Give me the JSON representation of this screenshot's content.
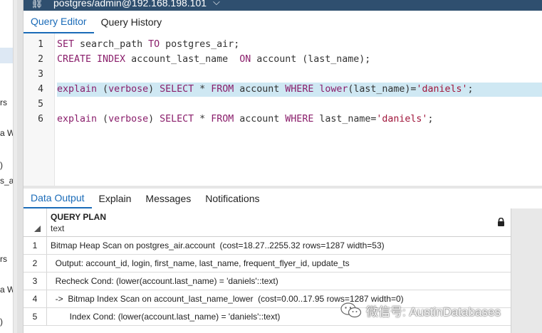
{
  "connection": {
    "title": "postgres/admin@192.168.198.101",
    "chevron": "⌵"
  },
  "editor_tabs": [
    {
      "label": "Query Editor",
      "active": true
    },
    {
      "label": "Query History",
      "active": false
    }
  ],
  "editor": {
    "lines": [
      {
        "num": "1",
        "segments": [
          {
            "t": "SET",
            "k": "kw"
          },
          {
            "t": " search_path ",
            "k": ""
          },
          {
            "t": "TO",
            "k": "kw"
          },
          {
            "t": " postgres_air;",
            "k": ""
          }
        ]
      },
      {
        "num": "2",
        "segments": [
          {
            "t": "CREATE INDEX",
            "k": "kw"
          },
          {
            "t": " account_last_name  ",
            "k": ""
          },
          {
            "t": "ON",
            "k": "kw"
          },
          {
            "t": " account (last_name);",
            "k": ""
          }
        ]
      },
      {
        "num": "3",
        "segments": []
      },
      {
        "num": "4",
        "highlight": true,
        "segments": [
          {
            "t": "explain",
            "k": "kw"
          },
          {
            "t": " (",
            "k": ""
          },
          {
            "t": "verbose",
            "k": "kw"
          },
          {
            "t": ") ",
            "k": ""
          },
          {
            "t": "SELECT",
            "k": "kw"
          },
          {
            "t": " * ",
            "k": ""
          },
          {
            "t": "FROM",
            "k": "kw"
          },
          {
            "t": " account ",
            "k": ""
          },
          {
            "t": "WHERE",
            "k": "kw"
          },
          {
            "t": " ",
            "k": ""
          },
          {
            "t": "lower",
            "k": "kw"
          },
          {
            "t": "(last_name)=",
            "k": ""
          },
          {
            "t": "'daniels'",
            "k": "str"
          },
          {
            "t": ";",
            "k": ""
          }
        ]
      },
      {
        "num": "5",
        "segments": []
      },
      {
        "num": "6",
        "segments": [
          {
            "t": "explain",
            "k": "kw"
          },
          {
            "t": " (",
            "k": ""
          },
          {
            "t": "verbose",
            "k": "kw"
          },
          {
            "t": ") ",
            "k": ""
          },
          {
            "t": "SELECT",
            "k": "kw"
          },
          {
            "t": " * ",
            "k": ""
          },
          {
            "t": "FROM",
            "k": "kw"
          },
          {
            "t": " account ",
            "k": ""
          },
          {
            "t": "WHERE",
            "k": "kw"
          },
          {
            "t": " last_name=",
            "k": ""
          },
          {
            "t": "'daniels'",
            "k": "str"
          },
          {
            "t": ";",
            "k": ""
          }
        ]
      }
    ]
  },
  "output_tabs": [
    {
      "label": "Data Output",
      "active": true
    },
    {
      "label": "Explain",
      "active": false
    },
    {
      "label": "Messages",
      "active": false
    },
    {
      "label": "Notifications",
      "active": false
    }
  ],
  "grid": {
    "column": {
      "name": "QUERY PLAN",
      "type": "text"
    },
    "rows": [
      {
        "num": "1",
        "value": "Bitmap Heap Scan on postgres_air.account  (cost=18.27..2255.32 rows=1287 width=53)"
      },
      {
        "num": "2",
        "value": "  Output: account_id, login, first_name, last_name, frequent_flyer_id, update_ts"
      },
      {
        "num": "3",
        "value": "  Recheck Cond: (lower(account.last_name) = 'daniels'::text)"
      },
      {
        "num": "4",
        "value": "  ->  Bitmap Index Scan on account_last_name_lower  (cost=0.00..17.95 rows=1287 width=0)"
      },
      {
        "num": "5",
        "value": "        Index Cond: (lower(account.last_name) = 'daniels'::text)"
      }
    ]
  },
  "tree_fragments": [
    "rs",
    "a W",
    ")",
    "s_ai",
    "rs",
    "a W",
    ")"
  ],
  "watermark": {
    "text": "微信号: AustinDatabases",
    "icon": "wechat-icon"
  },
  "colors": {
    "accent": "#1a6bb8",
    "header_bar": "#2f4f6f",
    "keyword": "#8a1e6b",
    "string": "#a0163b",
    "highlight": "#cfe8f3"
  }
}
